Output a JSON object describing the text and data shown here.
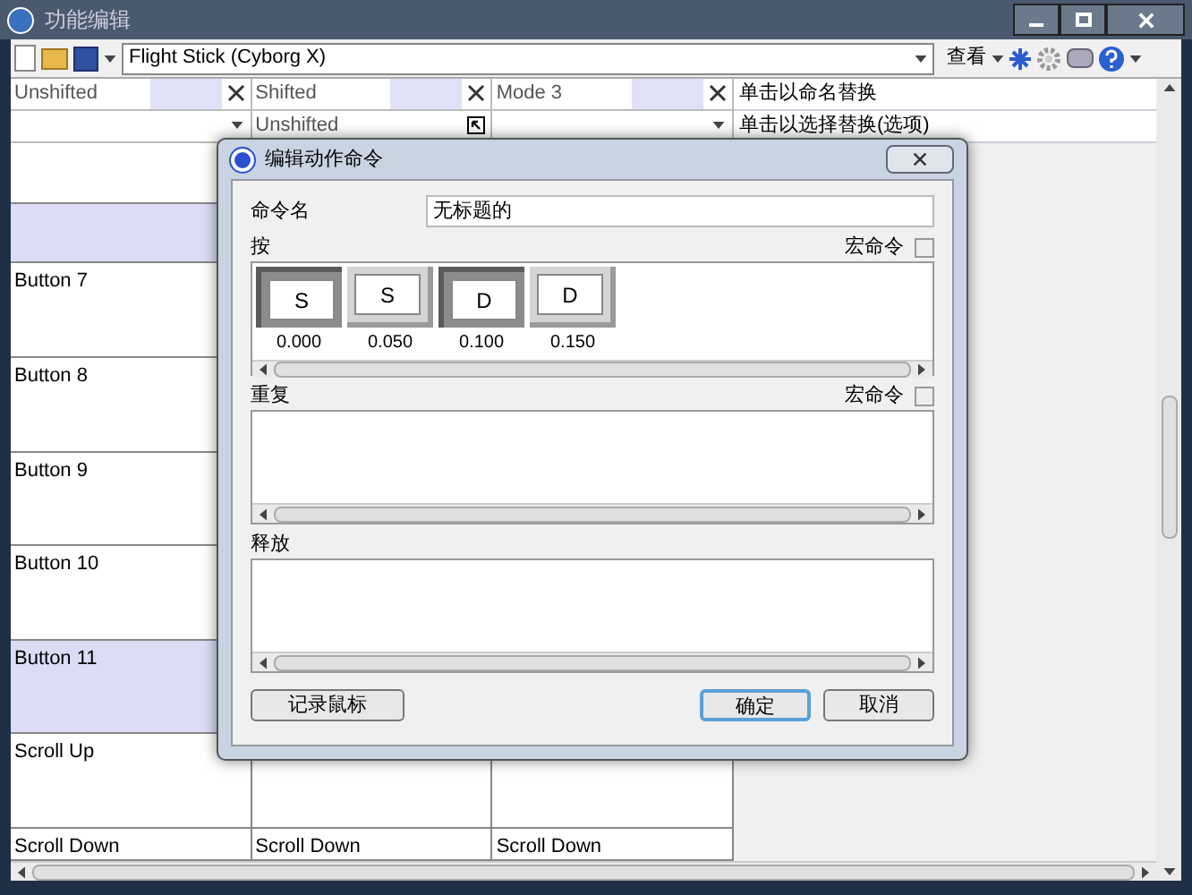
{
  "window": {
    "title": "功能编辑"
  },
  "toolbar": {
    "device": "Flight Stick (Cyborg X)",
    "view_menu": "查看"
  },
  "columns": [
    {
      "header": "Unshifted",
      "kind": "dropdown"
    },
    {
      "header": "Shifted",
      "kind": "value",
      "value": "Unshifted"
    },
    {
      "header": "Mode 3",
      "kind": "dropdown"
    }
  ],
  "rows": [
    {
      "cells": [],
      "highlighted": false
    },
    {
      "cells": [],
      "highlighted": true
    },
    {
      "cells": [
        "Button 7"
      ],
      "highlighted": false
    },
    {
      "cells": [
        "Button 8"
      ],
      "highlighted": false
    },
    {
      "cells": [
        "Button 9"
      ],
      "highlighted": false
    },
    {
      "cells": [
        "Button 10"
      ],
      "highlighted": false
    },
    {
      "cells": [
        "Button 11"
      ],
      "highlighted": true
    },
    {
      "cells": [
        "Scroll Up"
      ],
      "highlighted": false
    },
    {
      "cells": [
        "Scroll Down",
        "Scroll Down",
        "Scroll Down"
      ],
      "highlighted": false
    }
  ],
  "side_panel": [
    "单击以命名替换",
    "单击以选择替换(选项)"
  ],
  "dialog": {
    "title": "编辑动作命令",
    "name_label": "命令名",
    "name_value": "无标题的",
    "sections": [
      {
        "label": "按",
        "macro_label": "宏命令",
        "macro_checked": false,
        "keys": [
          {
            "key": "S",
            "time": "0.000",
            "pressed": true
          },
          {
            "key": "S",
            "time": "0.050",
            "pressed": false
          },
          {
            "key": "D",
            "time": "0.100",
            "pressed": true
          },
          {
            "key": "D",
            "time": "0.150",
            "pressed": false
          }
        ]
      },
      {
        "label": "重复",
        "macro_label": "宏命令",
        "macro_checked": false
      },
      {
        "label": "释放"
      }
    ],
    "buttons": [
      {
        "label": "记录鼠标",
        "default": false
      },
      {
        "label": "确定",
        "default": true
      },
      {
        "label": "取消",
        "default": false
      }
    ]
  }
}
